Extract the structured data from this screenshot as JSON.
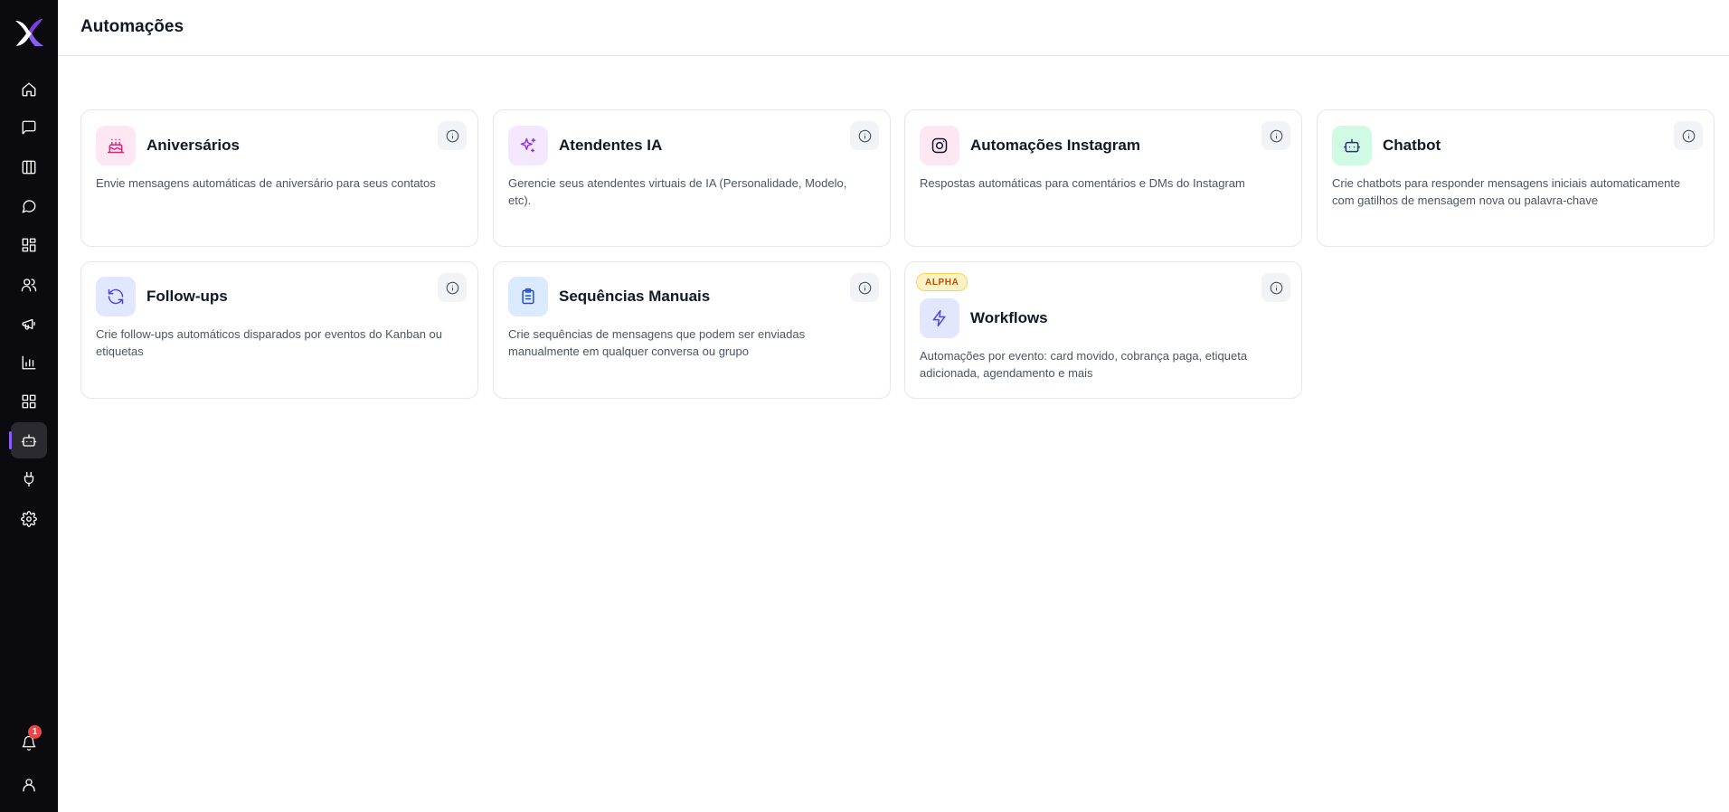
{
  "header": {
    "title": "Automações"
  },
  "sidebar": {
    "items": [
      {
        "name": "home",
        "icon": "home-icon"
      },
      {
        "name": "messages",
        "icon": "message-square-icon"
      },
      {
        "name": "kanban",
        "icon": "columns-icon"
      },
      {
        "name": "chat",
        "icon": "message-circle-icon"
      },
      {
        "name": "dashboard",
        "icon": "layout-dashboard-icon"
      },
      {
        "name": "contacts",
        "icon": "users-icon"
      },
      {
        "name": "campaigns",
        "icon": "megaphone-icon"
      },
      {
        "name": "reports",
        "icon": "bar-chart-icon"
      },
      {
        "name": "apps",
        "icon": "grid-icon"
      },
      {
        "name": "automations",
        "icon": "bot-icon",
        "active": true
      },
      {
        "name": "integrations",
        "icon": "plug-icon"
      },
      {
        "name": "settings",
        "icon": "gear-icon"
      }
    ],
    "notifications": {
      "icon": "bell-icon",
      "count": "1"
    },
    "profile": {
      "icon": "user-icon"
    }
  },
  "cards": [
    {
      "title": "Aniversários",
      "description": "Envie mensagens automáticas de aniversário para seus contatos",
      "icon": "cake-icon",
      "color": "#db2777",
      "bg": "#fce7f3"
    },
    {
      "title": "Atendentes IA",
      "description": "Gerencie seus atendentes virtuais de IA (Personalidade, Modelo, etc).",
      "icon": "sparkles-icon",
      "color": "#9333ea",
      "bg": "#f3e8ff"
    },
    {
      "title": "Automações Instagram",
      "description": "Respostas automáticas para comentários e DMs do Instagram",
      "icon": "instagram-icon",
      "color": "#111827",
      "bg": "#fce7f3"
    },
    {
      "title": "Chatbot",
      "description": "Crie chatbots para responder mensagens iniciais automaticamente com gatilhos de mensagem nova ou palavra-chave",
      "icon": "bot-icon",
      "color": "#312e81",
      "bg": "#d1fae5"
    },
    {
      "title": "Follow-ups",
      "description": "Crie follow-ups automáticos disparados por eventos do Kanban ou etiquetas",
      "icon": "refresh-icon",
      "color": "#4f46e5",
      "bg": "#e0e7ff"
    },
    {
      "title": "Sequências Manuais",
      "description": "Crie sequências de mensagens que podem ser enviadas manualmente em qualquer conversa ou grupo",
      "icon": "clipboard-list-icon",
      "color": "#1d4ed8",
      "bg": "#dbeafe"
    },
    {
      "title": "Workflows",
      "badge": "ALPHA",
      "description": "Automações por evento: card movido, cobrança paga, etiqueta adicionada, agendamento e mais",
      "icon": "zap-icon",
      "color": "#4f46e5",
      "bg": "#e0e7ff"
    }
  ],
  "info_icon": "info-icon",
  "accent": "#8b5cf6"
}
